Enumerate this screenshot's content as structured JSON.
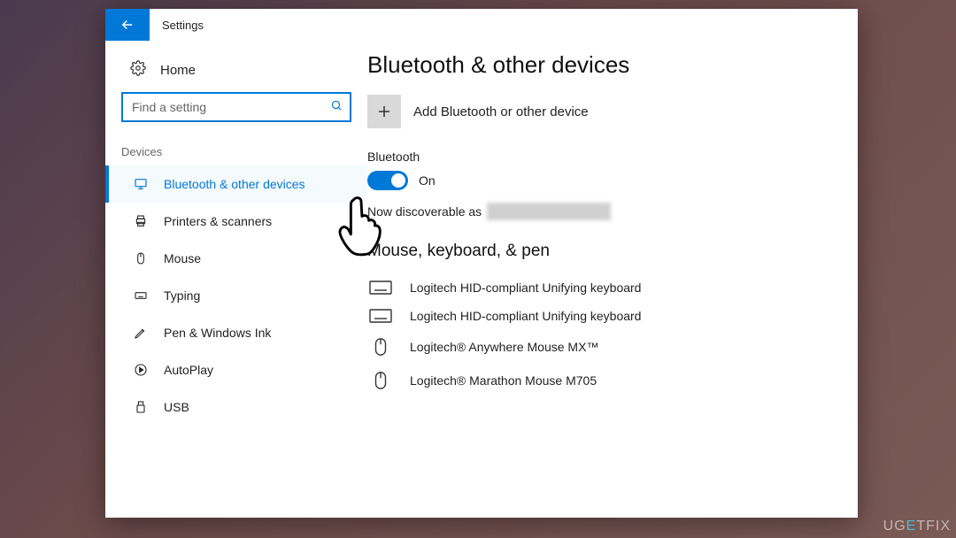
{
  "app": {
    "title": "Settings"
  },
  "sidebar": {
    "home": "Home",
    "search_placeholder": "Find a setting",
    "section": "Devices",
    "items": [
      {
        "icon": "bluetooth",
        "label": "Bluetooth & other devices"
      },
      {
        "icon": "printer",
        "label": "Printers & scanners"
      },
      {
        "icon": "mouse",
        "label": "Mouse"
      },
      {
        "icon": "keyboard",
        "label": "Typing"
      },
      {
        "icon": "pen",
        "label": "Pen & Windows Ink"
      },
      {
        "icon": "autoplay",
        "label": "AutoPlay"
      },
      {
        "icon": "usb",
        "label": "USB"
      }
    ]
  },
  "main": {
    "title": "Bluetooth & other devices",
    "add_label": "Add Bluetooth or other device",
    "bluetooth_label": "Bluetooth",
    "toggle_state": "On",
    "discover_prefix": "Now discoverable as",
    "section_title": "Mouse, keyboard, & pen",
    "devices": [
      {
        "icon": "keyboard",
        "label": "Logitech HID-compliant Unifying keyboard"
      },
      {
        "icon": "keyboard",
        "label": "Logitech HID-compliant Unifying keyboard"
      },
      {
        "icon": "mouse",
        "label": "Logitech® Anywhere Mouse MX™"
      },
      {
        "icon": "mouse",
        "label": "Logitech® Marathon Mouse M705"
      }
    ]
  },
  "watermark": "UGETFIX"
}
